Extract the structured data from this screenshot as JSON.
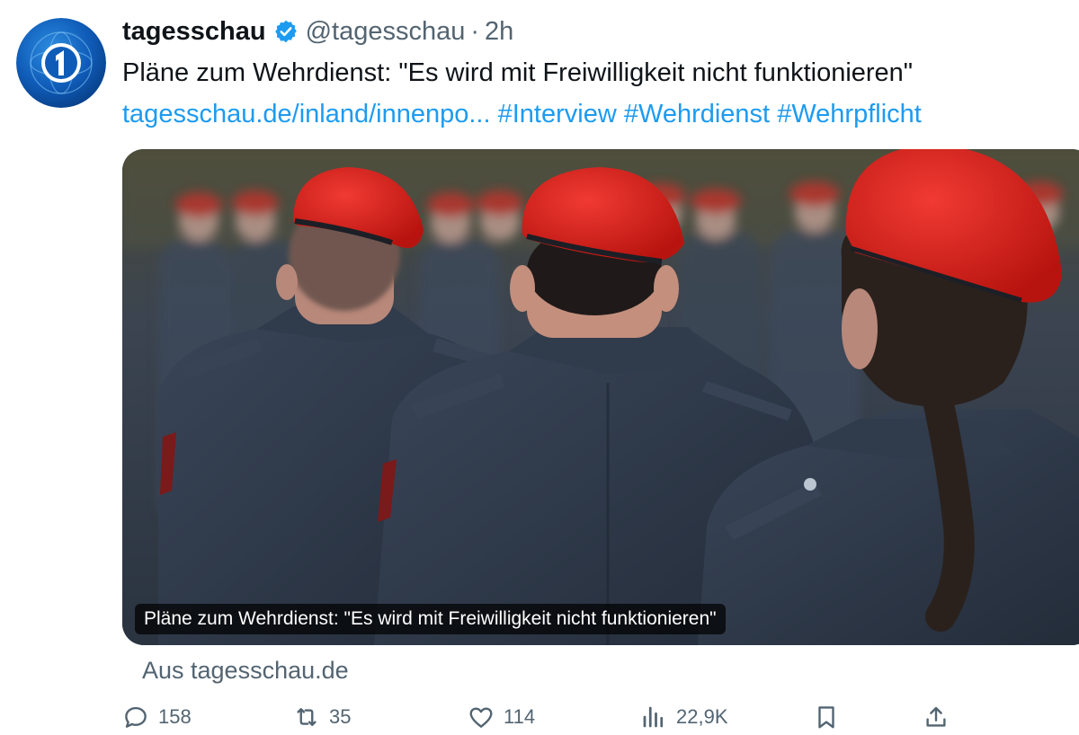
{
  "tweet": {
    "display_name": "tagesschau",
    "handle": "@tagesschau",
    "separator": "·",
    "time": "2h",
    "text": "Pläne zum Wehrdienst: \"Es wird mit Freiwilligkeit nicht funktionieren\"",
    "link": "tagesschau.de/inland/innenpo...",
    "hashtags": [
      "#Interview",
      "#Wehrdienst",
      "#Wehrpflicht"
    ],
    "verified_icon": "verified-badge-icon",
    "avatar_icon": "tagesschau-logo-icon"
  },
  "card": {
    "caption": "Pläne zum Wehrdienst: \"Es wird mit Freiwilligkeit nicht funktionieren\"",
    "source": "Aus tagesschau.de"
  },
  "actions": {
    "reply": {
      "icon": "reply-icon",
      "count": "158"
    },
    "retweet": {
      "icon": "retweet-icon",
      "count": "35"
    },
    "like": {
      "icon": "like-icon",
      "count": "114"
    },
    "views": {
      "icon": "views-icon",
      "count": "22,9K"
    },
    "bookmark": {
      "icon": "bookmark-icon"
    },
    "share": {
      "icon": "share-icon"
    }
  },
  "colors": {
    "link": "#1d9bf0",
    "secondary_text": "#536471",
    "primary_text": "#0f1419",
    "verified": "#1d9bf0",
    "beret": "#d8201f",
    "uniform": "#2e3a4b"
  }
}
